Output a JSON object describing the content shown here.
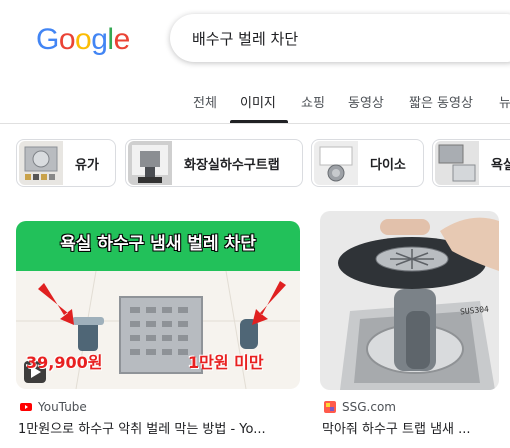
{
  "logo": {
    "letters": [
      "G",
      "o",
      "o",
      "g",
      "l",
      "e"
    ],
    "colors": [
      "#4285f4",
      "#ea4335",
      "#fbbc05",
      "#4285f4",
      "#34a853",
      "#ea4335"
    ]
  },
  "search": {
    "query": "배수구 벌레 차단"
  },
  "tabs": [
    {
      "label": "전체"
    },
    {
      "label": "이미지",
      "active": true
    },
    {
      "label": "쇼핑"
    },
    {
      "label": "동영상"
    },
    {
      "label": "짧은 동영상"
    },
    {
      "label": "뉴"
    }
  ],
  "chips": [
    {
      "label": "유가"
    },
    {
      "label": "화장실하수구트랩"
    },
    {
      "label": "다이소"
    },
    {
      "label": "욕실"
    }
  ],
  "results": [
    {
      "banner_text": "욕실 하수구 냄새 벌레 차단",
      "price_left": "39,900원",
      "price_right": "1만원 미만",
      "source": "YouTube",
      "title": "1만원으로 하수구 악취 벌레 막는 방법 - Yo..."
    },
    {
      "badge": "SUS304",
      "source": "SSG.com",
      "title": "막아줘 하수구 트랩 냄새 ..."
    }
  ],
  "icons": {
    "play": "play-icon",
    "youtube": "youtube-icon",
    "ssg": "ssg-icon"
  }
}
